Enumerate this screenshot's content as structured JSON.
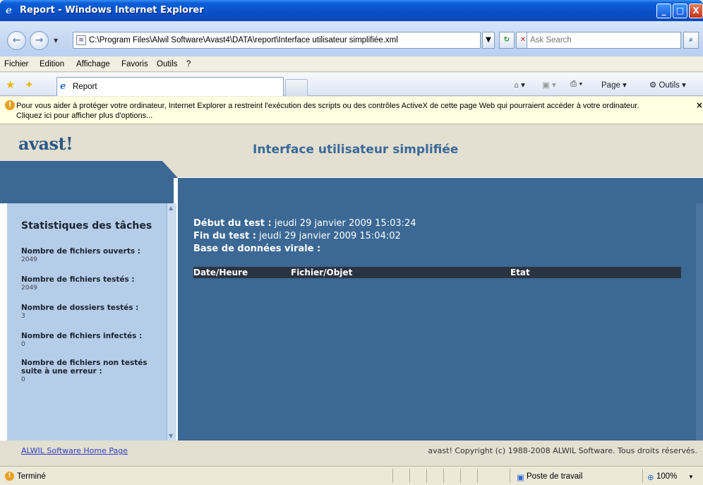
{
  "window": {
    "title": "Report - Windows Internet Explorer",
    "ie_logo": "e",
    "minimize": "_",
    "maximize": "□",
    "close": "X"
  },
  "address_bar": {
    "url": "C:\\Program Files\\Alwil Software\\Avast4\\DATA\\report\\Interface utilisateur simplifiée.xml",
    "search_placeholder": "Ask Search"
  },
  "menu": {
    "items": [
      "Fichier",
      "Edition",
      "Affichage",
      "Favoris",
      "Outils",
      "?"
    ]
  },
  "tabs": {
    "active_label": "Report"
  },
  "toolbar": {
    "page_label": "Page",
    "tools_label": "Outils"
  },
  "info_bar": {
    "message": "Pour vous aider à protéger votre ordinateur, Internet Explorer a restreint l'exécution des scripts ou des contrôles ActiveX de cette page Web qui pourraient accéder à votre ordinateur. Cliquez ici pour afficher plus d'options..."
  },
  "page": {
    "logo": "avast!",
    "title": "Interface utilisateur simplifiée",
    "sidebar": {
      "heading": "Statistiques des tâches",
      "stats": [
        {
          "label": "Nombre de fichiers ouverts :",
          "value": "2049"
        },
        {
          "label": "Nombre de fichiers testés :",
          "value": "2049"
        },
        {
          "label": "Nombre de dossiers testés :",
          "value": "3"
        },
        {
          "label": "Nombre de fichiers infectés :",
          "value": "0"
        },
        {
          "label": "Nombre de fichiers non testés suite à une erreur :",
          "value": "0"
        }
      ]
    },
    "main": {
      "start_label": "Début du test :",
      "start_value": " jeudi 29 janvier 2009 15:03:24",
      "end_label": "Fin du test :",
      "end_value": " jeudi 29 janvier 2009 15:04:02",
      "db_label": "Base de données virale :",
      "table_columns": [
        "Date/Heure",
        "Fichier/Objet",
        "Etat"
      ]
    },
    "footer": {
      "home_link": "ALWIL Software Home Page",
      "copyright": "avast! Copyright (c) 1988-2008 ALWIL Software. Tous droits réservés."
    }
  },
  "status_bar": {
    "status": "Terminé",
    "zone": "Poste de travail",
    "zoom": "100%"
  },
  "colors": {
    "header_bg": "#e3dfd1",
    "band_blue": "#3b6894",
    "sidebar_bg": "#b5cde8",
    "table_header_bg": "#2a3440",
    "title_text": "#3a6a98"
  }
}
